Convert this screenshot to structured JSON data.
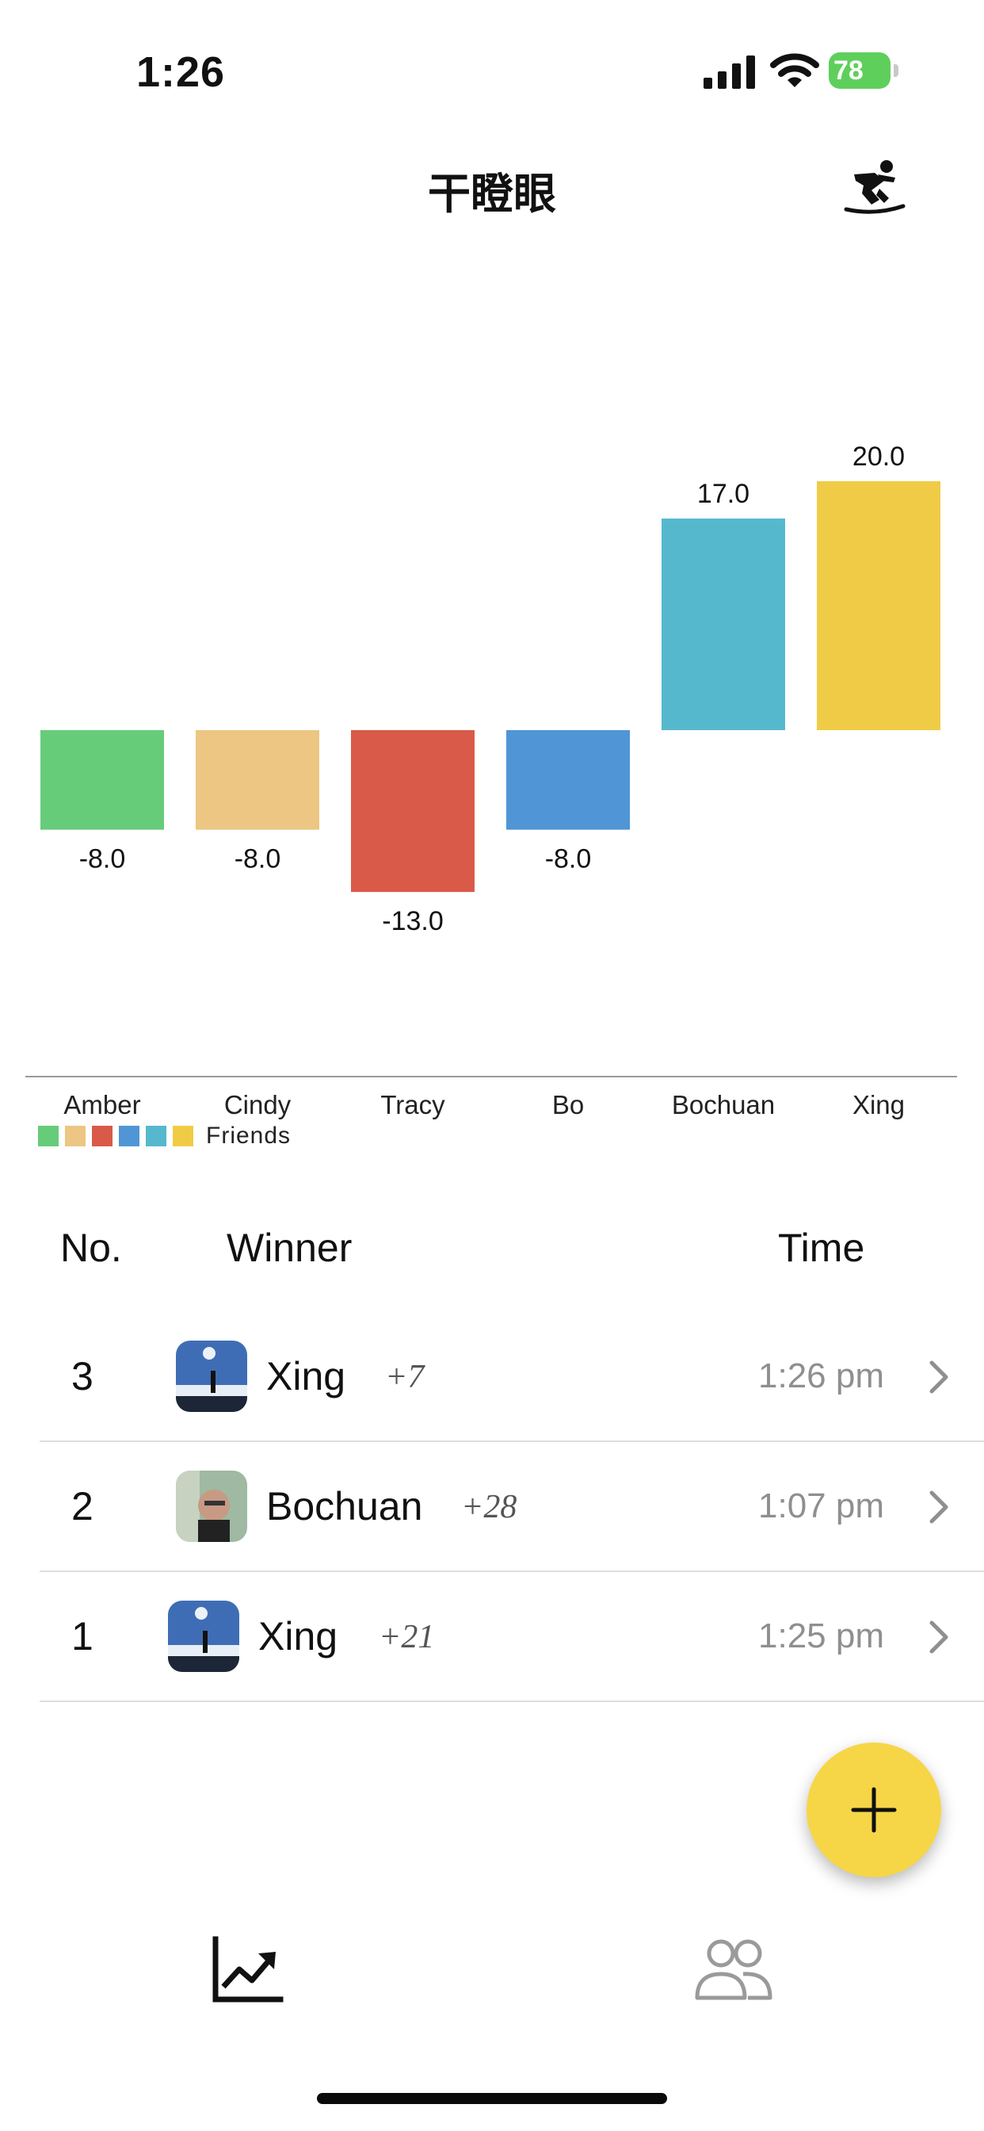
{
  "status_bar": {
    "time": "1:26",
    "battery": "78",
    "icons": [
      "signal-icon",
      "wifi-icon",
      "battery-charging-icon"
    ]
  },
  "header": {
    "title": "干瞪眼",
    "action_icon": "snowboarder-icon"
  },
  "colors": {
    "accent": "#f6d647",
    "series_colors": [
      "#66cc7a",
      "#ecc682",
      "#d95a48",
      "#5095d5",
      "#56b8cd",
      "#f0cc46"
    ]
  },
  "chart_data": {
    "type": "bar",
    "categories": [
      "Amber",
      "Cindy",
      "Tracy",
      "Bo",
      "Bochuan",
      "Xing"
    ],
    "series": [
      {
        "name": "Friends",
        "values": [
          -8.0,
          -8.0,
          -13.0,
          -8.0,
          17.0,
          20.0
        ]
      }
    ],
    "data_labels": [
      "-8.0",
      "-8.0",
      "-13.0",
      "-8.0",
      "17.0",
      "20.0"
    ],
    "legend": {
      "label": "Friends",
      "position": "bottom-left"
    },
    "grid": false,
    "ylim": [
      -13,
      20
    ]
  },
  "table": {
    "headers": {
      "no": "No.",
      "winner": "Winner",
      "time": "Time"
    },
    "rows": [
      {
        "no": "3",
        "name": "Xing",
        "score": "+7",
        "time": "1:26 pm",
        "avatar": "avatar-xing"
      },
      {
        "no": "2",
        "name": "Bochuan",
        "score": "+28",
        "time": "1:07 pm",
        "avatar": "avatar-bochuan"
      },
      {
        "no": "1",
        "name": "Xing",
        "score": "+21",
        "time": "1:25 pm",
        "avatar": "avatar-xing"
      }
    ]
  },
  "fab": {
    "icon": "plus-icon"
  },
  "tab_bar": {
    "tabs": [
      {
        "icon": "chart-trending-icon",
        "active": true
      },
      {
        "icon": "people-icon",
        "active": false
      }
    ]
  }
}
